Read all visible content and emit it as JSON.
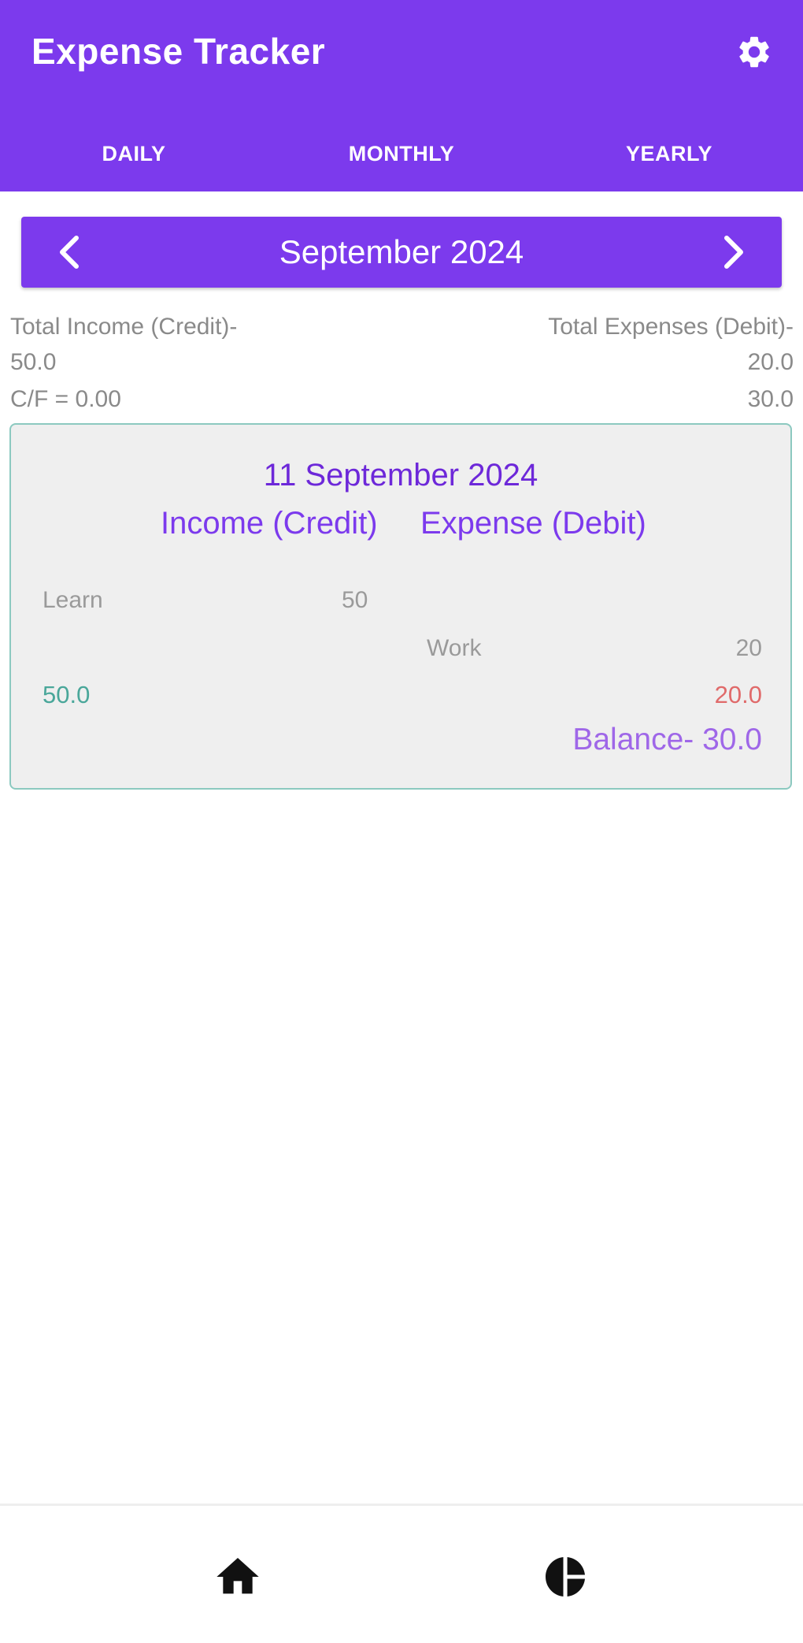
{
  "app_bar": {
    "title": "Expense Tracker",
    "settings_icon": "gear-icon",
    "tabs": [
      "DAILY",
      "MONTHLY",
      "YEARLY"
    ]
  },
  "period_selector": {
    "label": "September 2024",
    "prev_icon": "chevron-left-icon",
    "next_icon": "chevron-right-icon"
  },
  "summary": {
    "income_label": "Total Income (Credit)-",
    "income_value": "50.0",
    "expense_label": "Total Expenses (Debit)-",
    "expense_value": "20.0",
    "carry_forward": "C/F = 0.00",
    "balance_value": "30.0"
  },
  "day_card": {
    "date": "11 September 2024",
    "income_header": "Income (Credit)",
    "expense_header": "Expense (Debit)",
    "income_entries": [
      {
        "name": "Learn",
        "amount": "50"
      }
    ],
    "expense_entries": [
      {
        "name": "Work",
        "amount": "20"
      }
    ],
    "income_total": "50.0",
    "expense_total": "20.0",
    "balance": "Balance- 30.0"
  },
  "bottom_nav": {
    "items": [
      {
        "icon": "home-icon"
      },
      {
        "icon": "pie-chart-icon"
      }
    ]
  },
  "colors": {
    "primary": "#7c3aed",
    "card_border": "#8cc9c0",
    "income": "#4aa79a",
    "expense": "#e06a6a"
  }
}
